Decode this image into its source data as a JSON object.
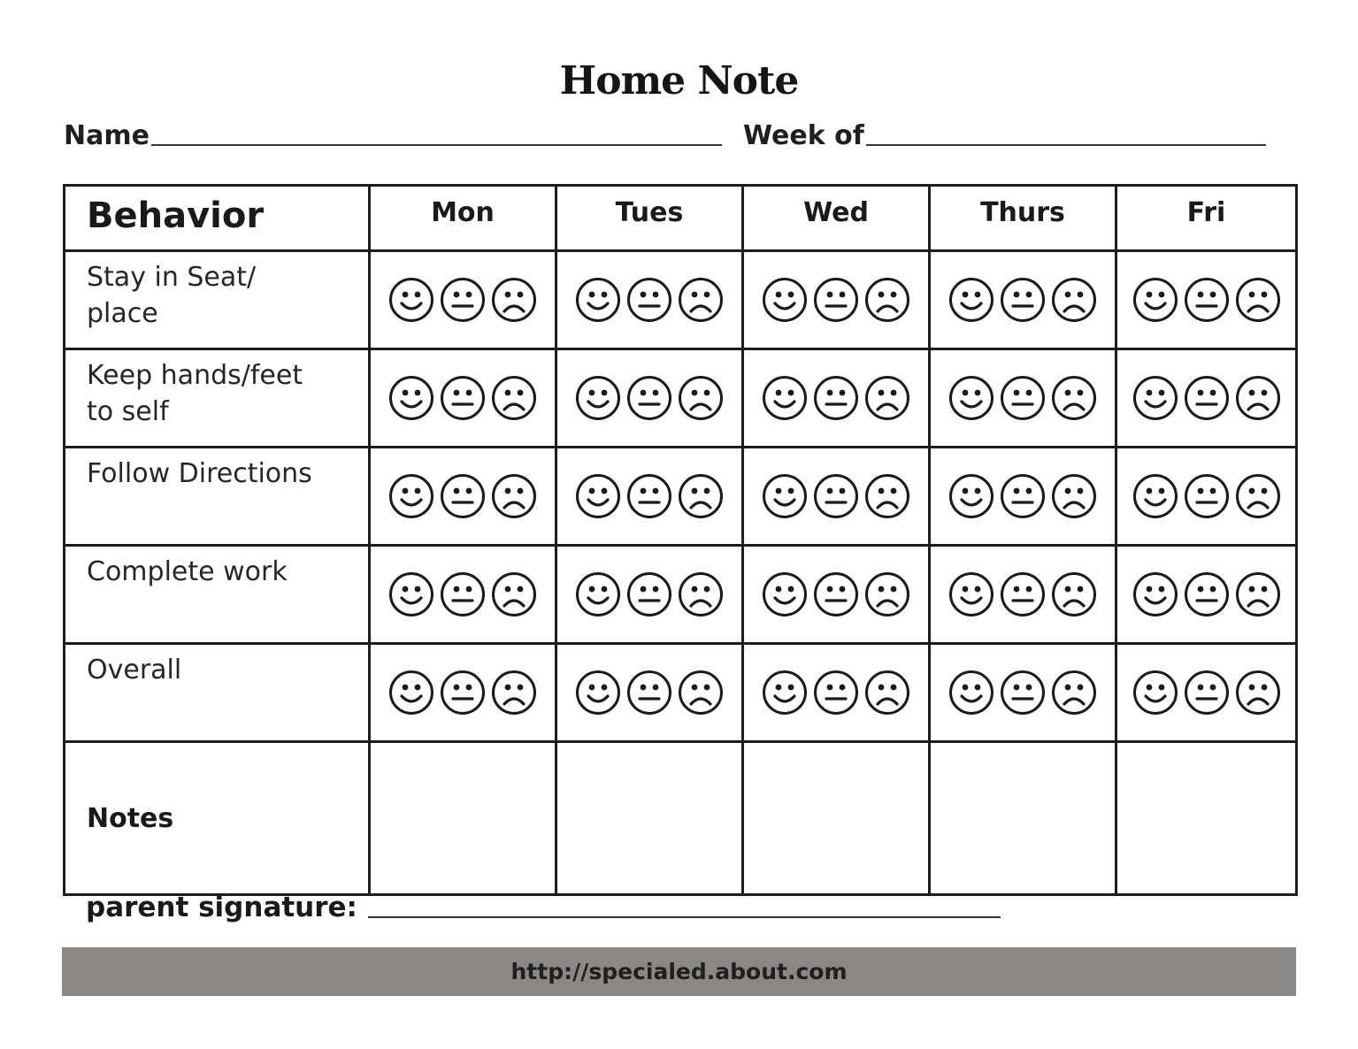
{
  "header": {
    "title": "Home Note",
    "name_label": "Name",
    "week_label": "Week of"
  },
  "table": {
    "behavior_header": "Behavior",
    "days": [
      "Mon",
      "Tues",
      "Wed",
      "Thurs",
      "Fri"
    ],
    "behaviors": [
      {
        "label_line1": "Stay in Seat/",
        "label_line2": "place"
      },
      {
        "label_line1": "Keep hands/feet",
        "label_line2": "to self"
      },
      {
        "label_line1": "Follow Directions",
        "label_line2": ""
      },
      {
        "label_line1": "Complete work",
        "label_line2": ""
      },
      {
        "label_line1": "Overall",
        "label_line2": ""
      }
    ],
    "rating_options": [
      "happy-face-icon",
      "neutral-face-icon",
      "sad-face-icon"
    ],
    "notes_label": "Notes"
  },
  "footer": {
    "signature_label": "parent signature:",
    "url": "http://specialed.about.com",
    "bar_color": "#8a8784"
  }
}
